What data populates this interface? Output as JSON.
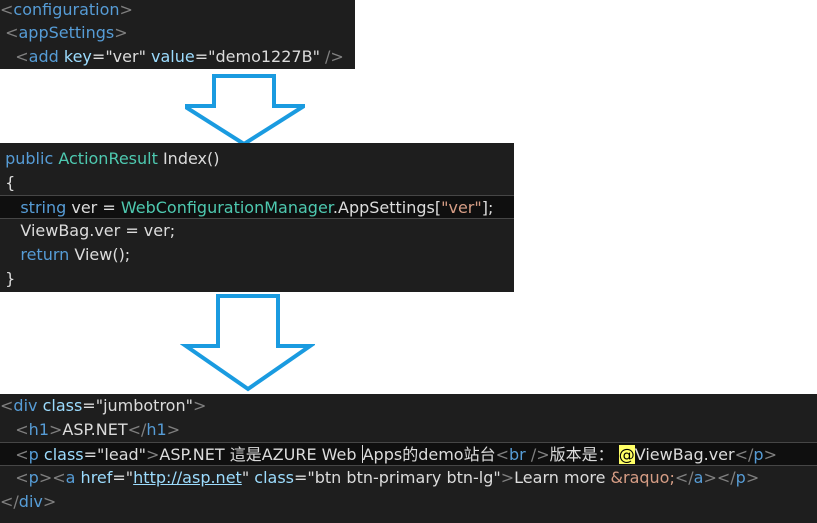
{
  "colors": {
    "panel_bg": "#1e1e1e",
    "bracket": "#808080",
    "tag": "#569cd6",
    "attr": "#9cdcfe",
    "string": "#d69d85",
    "text": "#dcdcdc",
    "type": "#4ec9b0",
    "keyword": "#569cd6",
    "link": "#9cdcfe",
    "arrow_stroke": "#1a9be0",
    "highlight": "#ffff66"
  },
  "panels": [
    {
      "name": "config-panel",
      "lines": [
        {
          "indent": "",
          "tokens": [
            {
              "t": "<",
              "c": "bracket"
            },
            {
              "t": "configuration",
              "c": "tag"
            },
            {
              "t": ">",
              "c": "bracket"
            }
          ]
        },
        {
          "indent": " ",
          "tokens": [
            {
              "t": "<",
              "c": "bracket"
            },
            {
              "t": "appSettings",
              "c": "tag"
            },
            {
              "t": ">",
              "c": "bracket"
            }
          ]
        },
        {
          "indent": "   ",
          "tokens": [
            {
              "t": "<",
              "c": "bracket"
            },
            {
              "t": "add",
              "c": "tag"
            },
            {
              "t": " ",
              "c": "text"
            },
            {
              "t": "key",
              "c": "attr"
            },
            {
              "t": "=",
              "c": "text"
            },
            {
              "t": "\"",
              "c": "text"
            },
            {
              "t": "ver",
              "c": "text"
            },
            {
              "t": "\"",
              "c": "text"
            },
            {
              "t": " ",
              "c": "text"
            },
            {
              "t": "value",
              "c": "attr"
            },
            {
              "t": "=",
              "c": "text"
            },
            {
              "t": "\"",
              "c": "text"
            },
            {
              "t": "demo1227B",
              "c": "text"
            },
            {
              "t": "\"",
              "c": "text"
            },
            {
              "t": " />",
              "c": "bracket"
            }
          ]
        }
      ]
    },
    {
      "name": "controller-panel",
      "lines": [
        {
          "indent": " ",
          "tokens": [
            {
              "t": "public",
              "c": "keyword"
            },
            {
              "t": " ",
              "c": "text"
            },
            {
              "t": "ActionResult",
              "c": "type"
            },
            {
              "t": " Index()",
              "c": "text"
            }
          ]
        },
        {
          "indent": " ",
          "tokens": [
            {
              "t": "{",
              "c": "text"
            }
          ]
        },
        {
          "indent": "    ",
          "highlight": true,
          "tokens": [
            {
              "t": "string",
              "c": "keyword"
            },
            {
              "t": " ver = ",
              "c": "text"
            },
            {
              "t": "WebConfigurationManager",
              "c": "type"
            },
            {
              "t": ".AppSettings[",
              "c": "text"
            },
            {
              "t": "\"ver\"",
              "c": "string"
            },
            {
              "t": "];",
              "c": "text"
            }
          ]
        },
        {
          "indent": "    ",
          "tokens": [
            {
              "t": "ViewBag.ver = ver;",
              "c": "text"
            }
          ]
        },
        {
          "indent": "    ",
          "tokens": [
            {
              "t": "return",
              "c": "keyword"
            },
            {
              "t": " View();",
              "c": "text"
            }
          ]
        },
        {
          "indent": " ",
          "tokens": [
            {
              "t": "}",
              "c": "text"
            }
          ]
        }
      ]
    },
    {
      "name": "view-panel",
      "lines": [
        {
          "indent": "",
          "tokens": [
            {
              "t": "<",
              "c": "bracket"
            },
            {
              "t": "div",
              "c": "tag"
            },
            {
              "t": " ",
              "c": "text"
            },
            {
              "t": "class",
              "c": "attr"
            },
            {
              "t": "=",
              "c": "text"
            },
            {
              "t": "\"",
              "c": "text"
            },
            {
              "t": "jumbotron",
              "c": "text"
            },
            {
              "t": "\"",
              "c": "text"
            },
            {
              "t": ">",
              "c": "bracket"
            }
          ]
        },
        {
          "indent": "   ",
          "tokens": [
            {
              "t": "<",
              "c": "bracket"
            },
            {
              "t": "h1",
              "c": "tag"
            },
            {
              "t": ">",
              "c": "bracket"
            },
            {
              "t": "ASP.NET",
              "c": "text"
            },
            {
              "t": "</",
              "c": "bracket"
            },
            {
              "t": "h1",
              "c": "tag"
            },
            {
              "t": ">",
              "c": "bracket"
            }
          ]
        },
        {
          "indent": "   ",
          "highlight": true,
          "tokens": [
            {
              "t": "<",
              "c": "bracket"
            },
            {
              "t": "p",
              "c": "tag"
            },
            {
              "t": " ",
              "c": "text"
            },
            {
              "t": "class",
              "c": "attr"
            },
            {
              "t": "=",
              "c": "text"
            },
            {
              "t": "\"",
              "c": "text"
            },
            {
              "t": "lead",
              "c": "text"
            },
            {
              "t": "\"",
              "c": "text"
            },
            {
              "t": ">",
              "c": "bracket"
            },
            {
              "t": "ASP.NET 這是AZURE Web ",
              "c": "text"
            },
            {
              "t": "",
              "c": "caret"
            },
            {
              "t": "Apps的demo站台",
              "c": "text"
            },
            {
              "t": "<",
              "c": "bracket"
            },
            {
              "t": "br",
              "c": "tag"
            },
            {
              "t": " />",
              "c": "bracket"
            },
            {
              "t": "版本是： ",
              "c": "text"
            },
            {
              "t": "@",
              "c": "at"
            },
            {
              "t": "ViewBag.ver",
              "c": "text"
            },
            {
              "t": "</",
              "c": "bracket"
            },
            {
              "t": "p",
              "c": "tag"
            },
            {
              "t": ">",
              "c": "bracket"
            }
          ]
        },
        {
          "indent": "   ",
          "tokens": [
            {
              "t": "<",
              "c": "bracket"
            },
            {
              "t": "p",
              "c": "tag"
            },
            {
              "t": ">",
              "c": "bracket"
            },
            {
              "t": "<",
              "c": "bracket"
            },
            {
              "t": "a",
              "c": "tag"
            },
            {
              "t": " ",
              "c": "text"
            },
            {
              "t": "href",
              "c": "attr"
            },
            {
              "t": "=",
              "c": "text"
            },
            {
              "t": "\"",
              "c": "text"
            },
            {
              "t": "http://asp.net",
              "c": "link"
            },
            {
              "t": "\"",
              "c": "text"
            },
            {
              "t": " ",
              "c": "text"
            },
            {
              "t": "class",
              "c": "attr"
            },
            {
              "t": "=",
              "c": "text"
            },
            {
              "t": "\"",
              "c": "text"
            },
            {
              "t": "btn btn-primary btn-lg",
              "c": "text"
            },
            {
              "t": "\"",
              "c": "text"
            },
            {
              "t": ">",
              "c": "bracket"
            },
            {
              "t": "Learn more ",
              "c": "text"
            },
            {
              "t": "&raquo;",
              "c": "string"
            },
            {
              "t": "</",
              "c": "bracket"
            },
            {
              "t": "a",
              "c": "tag"
            },
            {
              "t": ">",
              "c": "bracket"
            },
            {
              "t": "</",
              "c": "bracket"
            },
            {
              "t": "p",
              "c": "tag"
            },
            {
              "t": ">",
              "c": "bracket"
            }
          ]
        },
        {
          "indent": "",
          "tokens": [
            {
              "t": "</",
              "c": "bracket"
            },
            {
              "t": "div",
              "c": "tag"
            },
            {
              "t": ">",
              "c": "bracket"
            }
          ]
        }
      ]
    }
  ]
}
